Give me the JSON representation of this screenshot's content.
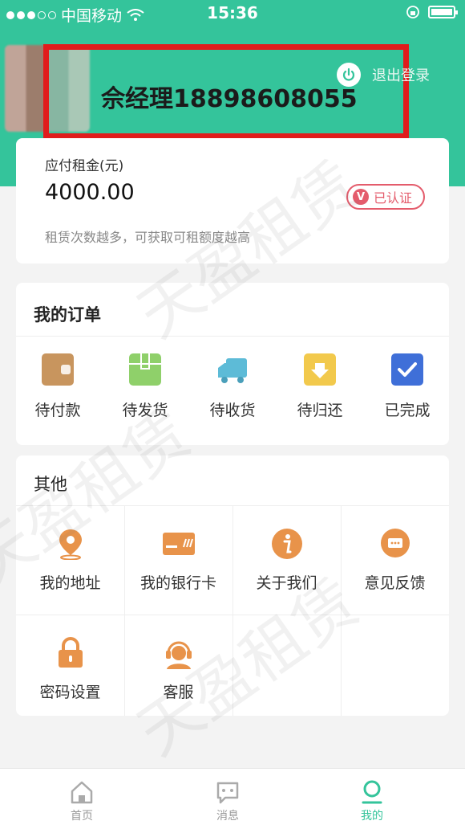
{
  "status_bar": {
    "carrier": "中国移动",
    "time": "15:36"
  },
  "header": {
    "user_name": "佘经理18898608055",
    "logout_label": "退出登录"
  },
  "rent": {
    "label": "应付租金(元)",
    "amount": "4000.00",
    "badge": "已认证",
    "tip": "租赁次数越多，可获取可租额度越高"
  },
  "orders": {
    "title": "我的订单",
    "items": [
      {
        "label": "待付款",
        "icon": "wallet-icon"
      },
      {
        "label": "待发货",
        "icon": "package-icon"
      },
      {
        "label": "待收货",
        "icon": "truck-icon"
      },
      {
        "label": "待归还",
        "icon": "return-box-icon"
      },
      {
        "label": "已完成",
        "icon": "check-icon"
      }
    ]
  },
  "other": {
    "title": "其他",
    "items": [
      {
        "label": "我的地址",
        "icon": "location-pin-icon"
      },
      {
        "label": "我的银行卡",
        "icon": "bank-card-icon"
      },
      {
        "label": "关于我们",
        "icon": "info-icon"
      },
      {
        "label": "意见反馈",
        "icon": "chat-bubble-icon"
      },
      {
        "label": "密码设置",
        "icon": "lock-icon"
      },
      {
        "label": "客服",
        "icon": "headset-agent-icon"
      }
    ]
  },
  "tabbar": {
    "items": [
      {
        "label": "首页",
        "icon": "home-icon",
        "active": false
      },
      {
        "label": "消息",
        "icon": "message-icon",
        "active": false
      },
      {
        "label": "我的",
        "icon": "profile-icon",
        "active": true
      }
    ]
  },
  "watermark": "天盈租赁",
  "colors": {
    "brand_green": "#34c49b",
    "highlight_red": "#e01c1c",
    "badge_red": "#e45c6c",
    "icon_orange": "#e8934a",
    "check_blue": "#3f6fd8"
  }
}
